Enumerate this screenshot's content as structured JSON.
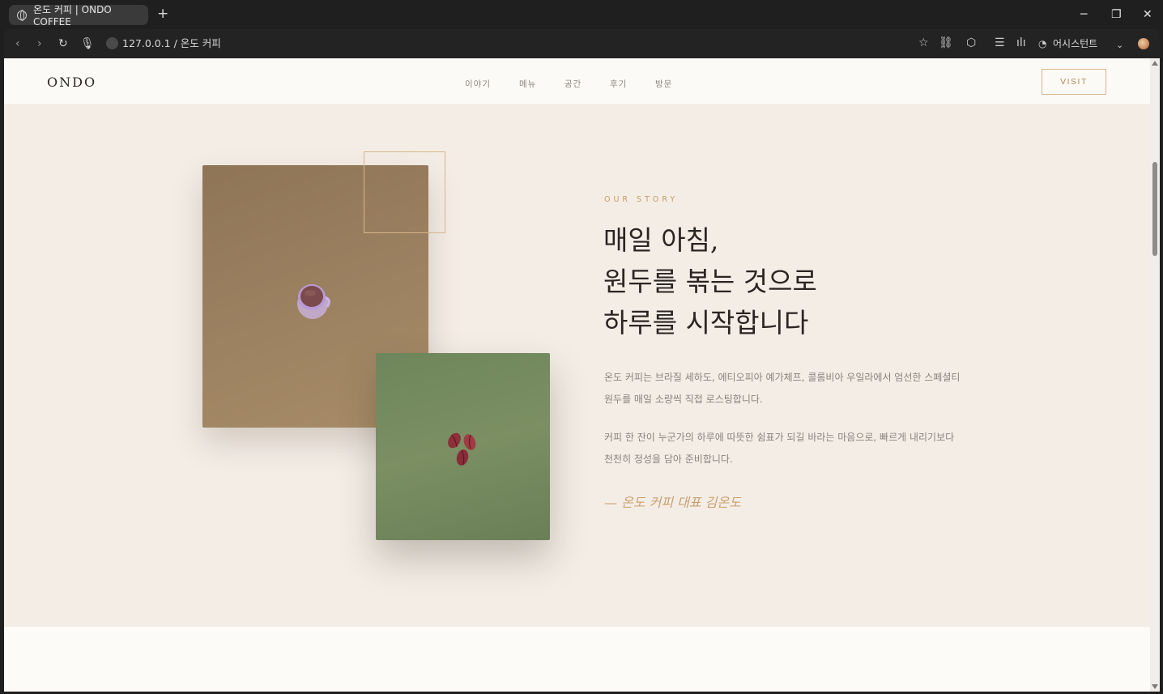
{
  "browser": {
    "tab_title": "온도 커피 | ONDO COFFEE",
    "new_tab": "+",
    "url": "127.0.0.1 / 온도 커피",
    "assistant_label": "어시스턴트",
    "minimize": "─",
    "restore": "❐",
    "close": "✕"
  },
  "header": {
    "logo": "ONDO",
    "nav": [
      "이야기",
      "메뉴",
      "공간",
      "후기",
      "방문"
    ],
    "cta": "VISIT"
  },
  "story": {
    "eyebrow": "OUR STORY",
    "headline_lines": [
      "매일 아침,",
      "원두를 볶는 것으로",
      "하루를 시작합니다"
    ],
    "paragraphs": [
      "온도 커피는 브라질 세하도, 에티오피아 예가체프, 콜롬비아 우일라에서 엄선한 스페셜티 원두를 매일 소량씩 직접 로스팅합니다.",
      "커피 한 잔이 누군가의 하루에 따뜻한 쉼표가 되길 바라는 마음으로, 빠르게 내리기보다 천천히 정성을 담아 준비합니다."
    ],
    "signature": "— 온도 커피 대표 김온도"
  },
  "colors": {
    "accent": "#c89b66",
    "background": "#f4ede6",
    "header_bg": "#fcfaf6",
    "photo_brown": "#9c8261",
    "photo_green": "#7b8f63"
  },
  "icons": {
    "tab": "globe-icon",
    "back": "arrow-left-icon",
    "forward": "arrow-right-icon",
    "reload": "reload-icon",
    "mic": "microphone-icon",
    "star": "star-icon",
    "link": "link-icon",
    "extensions": "puzzle-icon",
    "reader": "reader-icon",
    "voice": "voice-wave-icon",
    "assistant": "assistant-icon",
    "menu": "chevron-down-icon"
  }
}
